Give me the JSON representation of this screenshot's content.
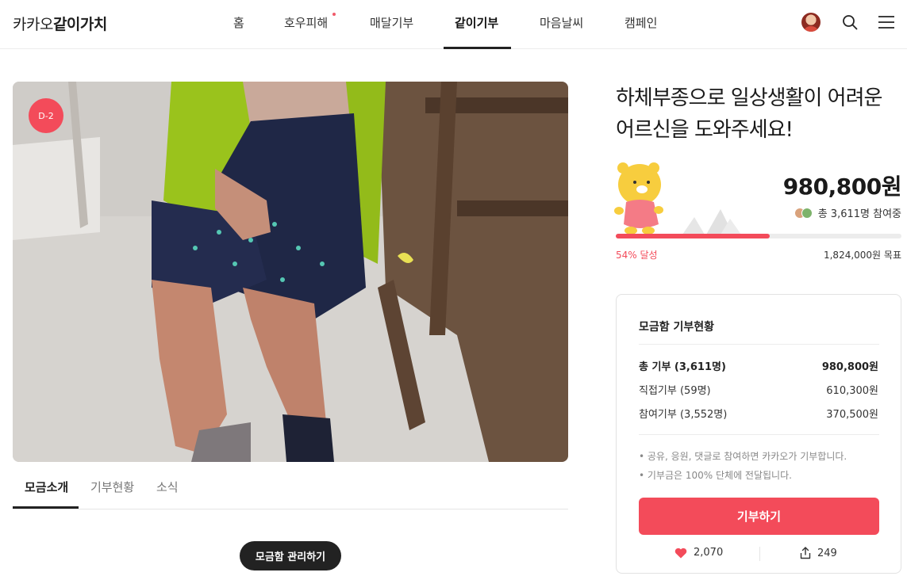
{
  "header": {
    "logo_light": "카카오",
    "logo_bold": "같이가치",
    "nav": [
      {
        "label": "홈"
      },
      {
        "label": "호우피해"
      },
      {
        "label": "매달기부"
      },
      {
        "label": "같이기부"
      },
      {
        "label": "마음날씨"
      },
      {
        "label": "캠페인"
      }
    ],
    "active_nav": "같이기부"
  },
  "hero": {
    "badge": "D-2"
  },
  "tabs": [
    {
      "label": "모금소개"
    },
    {
      "label": "기부현황"
    },
    {
      "label": "소식"
    }
  ],
  "manage_button": "모금함 관리하기",
  "campaign": {
    "title": "하체부종으로 일상생활이 어려운 어르신을 도와주세요!",
    "amount": "980,800원",
    "participants": "총 3,611명 참여중",
    "progress_percent": 54,
    "rate_label": "54% 달성",
    "goal": "1,824,000원 목표"
  },
  "status_card": {
    "title": "모금함 기부현황",
    "rows": [
      {
        "label": "총 기부 (3,611명)",
        "value": "980,800원"
      },
      {
        "label": "직접기부 (59명)",
        "value": "610,300원"
      },
      {
        "label": "참여기부 (3,552명)",
        "value": "370,500원"
      }
    ],
    "notes": [
      "• 공유, 응원, 댓글로 참여하면 카카오가 기부합니다.",
      "• 기부금은 100% 단체에 전달됩니다."
    ],
    "donate_button": "기부하기",
    "likes": "2,070",
    "shares": "249"
  },
  "colors": {
    "accent": "#f34b5a",
    "dark_button": "#222222"
  }
}
